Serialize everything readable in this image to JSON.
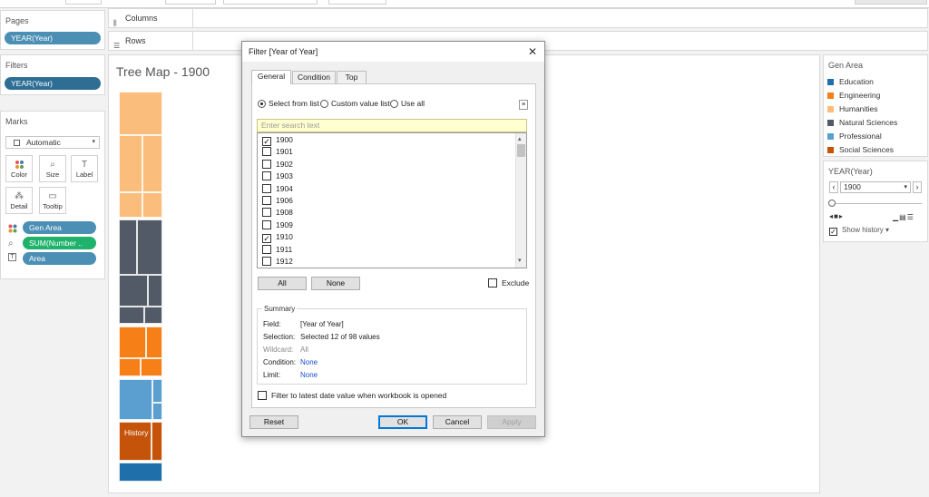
{
  "left": {
    "pages_title": "Pages",
    "pages_pill": "YEAR(Year)",
    "filters_title": "Filters",
    "filters_pill": "YEAR(Year)",
    "marks_title": "Marks",
    "mark_type": "Automatic",
    "buttons": [
      "Color",
      "Size",
      "Label",
      "Detail",
      "Tooltip"
    ],
    "mark_pills": [
      "Gen Area",
      "SUM(Number ..",
      "Area"
    ]
  },
  "shelves": {
    "columns": "Columns",
    "rows": "Rows"
  },
  "viz": {
    "title": "Tree Map - 1900",
    "history_label": "History"
  },
  "legend": {
    "title": "Gen Area",
    "items": [
      {
        "label": "Education",
        "color": "#1f6faa"
      },
      {
        "label": "Engineering",
        "color": "#f77f17"
      },
      {
        "label": "Humanities",
        "color": "#fbbd7b"
      },
      {
        "label": "Natural Sciences",
        "color": "#525a67"
      },
      {
        "label": "Professional",
        "color": "#5b9fd0"
      },
      {
        "label": "Social Sciences",
        "color": "#c5530a"
      }
    ]
  },
  "year_card": {
    "title": "YEAR(Year)",
    "value": "1900",
    "show_history": "Show history"
  },
  "dialog": {
    "title": "Filter [Year of Year]",
    "tabs": [
      "General",
      "Condition",
      "Top"
    ],
    "radios": [
      "Select from list",
      "Custom value list",
      "Use all"
    ],
    "search_placeholder": "Enter search text",
    "list": [
      {
        "label": "1900",
        "checked": true
      },
      {
        "label": "1901",
        "checked": false
      },
      {
        "label": "1902",
        "checked": false
      },
      {
        "label": "1903",
        "checked": false
      },
      {
        "label": "1904",
        "checked": false
      },
      {
        "label": "1906",
        "checked": false
      },
      {
        "label": "1908",
        "checked": false
      },
      {
        "label": "1909",
        "checked": false
      },
      {
        "label": "1910",
        "checked": true
      },
      {
        "label": "1911",
        "checked": false
      },
      {
        "label": "1912",
        "checked": false
      }
    ],
    "all_button": "All",
    "none_button": "None",
    "exclude_label": "Exclude",
    "summary": {
      "title": "Summary",
      "rows": [
        {
          "k": "Field:",
          "v": "[Year of Year]"
        },
        {
          "k": "Selection:",
          "v": "Selected 12 of 98 values"
        },
        {
          "k": "Wildcard:",
          "v": "All"
        },
        {
          "k": "Condition:",
          "v": "None"
        },
        {
          "k": "Limit:",
          "v": "None"
        }
      ]
    },
    "latest_label": "Filter to latest date value when workbook is opened",
    "reset": "Reset",
    "ok": "OK",
    "cancel": "Cancel",
    "apply": "Apply"
  }
}
